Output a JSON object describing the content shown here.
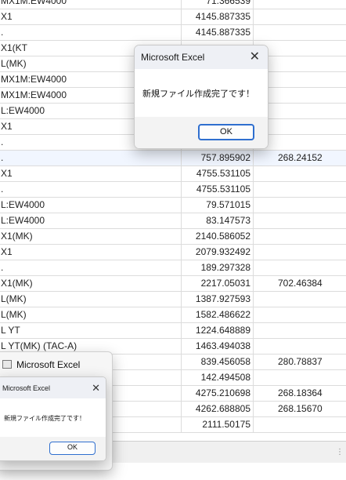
{
  "sheet": {
    "rows": [
      {
        "a": "MX1M:EW4000",
        "b": "71.366539",
        "c": ""
      },
      {
        "a": "X1",
        "b": "4145.887335",
        "c": ""
      },
      {
        "a": ".",
        "b": "4145.887335",
        "c": ""
      },
      {
        "a": "X1(KT",
        "b": "",
        "c": ""
      },
      {
        "a": "L(MK)",
        "b": "",
        "c": ""
      },
      {
        "a": "MX1M:EW4000",
        "b": "",
        "c": ""
      },
      {
        "a": "MX1M:EW4000",
        "b": "",
        "c": ""
      },
      {
        "a": "L:EW4000",
        "b": "",
        "c": ""
      },
      {
        "a": "X1",
        "b": "",
        "c": ""
      },
      {
        "a": ".",
        "b": "",
        "c": ""
      },
      {
        "a": ".",
        "b": "757.895902",
        "c": "268.24152"
      },
      {
        "a": "X1",
        "b": "4755.531105",
        "c": ""
      },
      {
        "a": ".",
        "b": "4755.531105",
        "c": ""
      },
      {
        "a": "L:EW4000",
        "b": "79.571015",
        "c": ""
      },
      {
        "a": "L:EW4000",
        "b": "83.147573",
        "c": ""
      },
      {
        "a": "X1(MK)",
        "b": "2140.586052",
        "c": ""
      },
      {
        "a": "X1",
        "b": "2079.932492",
        "c": ""
      },
      {
        "a": ".",
        "b": "189.297328",
        "c": ""
      },
      {
        "a": "X1(MK)",
        "b": "2217.05031",
        "c": "702.46384"
      },
      {
        "a": "L(MK)",
        "b": "1387.927593",
        "c": ""
      },
      {
        "a": "L(MK)",
        "b": "1582.486622",
        "c": ""
      },
      {
        "a": "L YT",
        "b": "1224.648889",
        "c": ""
      },
      {
        "a": "L YT(MK) (TAC-A)",
        "b": "1463.494038",
        "c": ""
      },
      {
        "a": "",
        "b": "839.456058",
        "c": "280.78837"
      },
      {
        "a": "",
        "b": "142.494508",
        "c": ""
      },
      {
        "a": "",
        "b": "4275.210698",
        "c": "268.18364"
      },
      {
        "a": "",
        "b": "4262.688805",
        "c": "268.15670"
      },
      {
        "a": "",
        "b": "2111.50175",
        "c": ""
      }
    ]
  },
  "dialog_main": {
    "title": "Microsoft Excel",
    "message": "新規ファイル作成完了です！",
    "ok_label": "OK",
    "close_glyph": "✕"
  },
  "excel_window": {
    "title": "Microsoft Excel"
  },
  "dialog_small": {
    "title": "Microsoft Excel",
    "message": "新規ファイル作成完了です！",
    "ok_label": "OK",
    "close_glyph": "✕"
  },
  "status": {
    "dots": "⋮"
  }
}
